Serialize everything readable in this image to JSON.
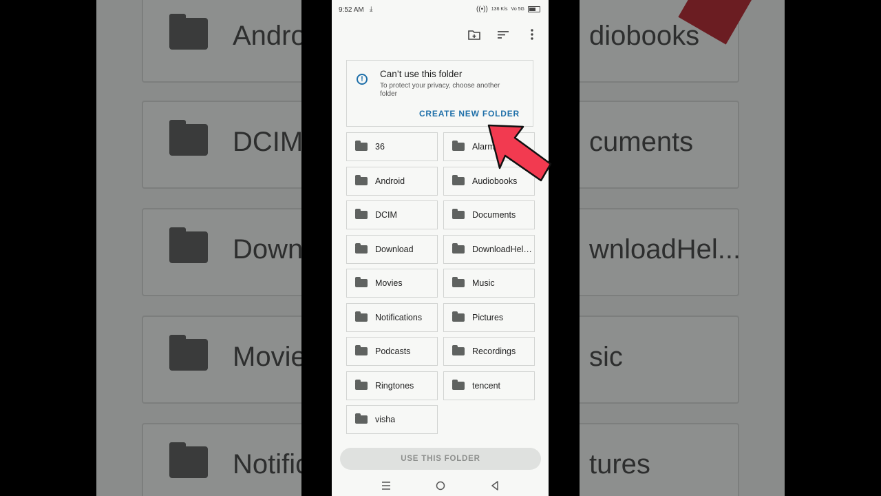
{
  "background": {
    "left_items": [
      "Andro",
      "DCIM",
      "Down",
      "Movie",
      "Notific"
    ],
    "right_items": [
      "diobooks",
      "cuments",
      "wnloadHel...",
      "sic",
      "tures"
    ]
  },
  "statusbar": {
    "time": "9:52 AM",
    "download_icon": "download-icon",
    "hotspot_icon": "hotspot-icon",
    "speed": "136 K/s",
    "signal": "Vo 5G",
    "battery": "81"
  },
  "toolbar": {
    "new_folder_icon": "create-new-folder-icon",
    "sort_icon": "sort-icon",
    "more_icon": "more-vert-icon"
  },
  "notice": {
    "title": "Can’t use this folder",
    "subtitle": "To protect your privacy, choose another folder",
    "action": "CREATE NEW FOLDER"
  },
  "folders": [
    "36",
    "Alarms",
    "Android",
    "Audiobooks",
    "DCIM",
    "Documents",
    "Download",
    "DownloadHelper",
    "Movies",
    "Music",
    "Notifications",
    "Pictures",
    "Podcasts",
    "Recordings",
    "Ringtones",
    "tencent",
    "visha"
  ],
  "use_button": "USE THIS FOLDER",
  "colors": {
    "accent": "#1e6fa9",
    "arrow": "#f23a50"
  }
}
